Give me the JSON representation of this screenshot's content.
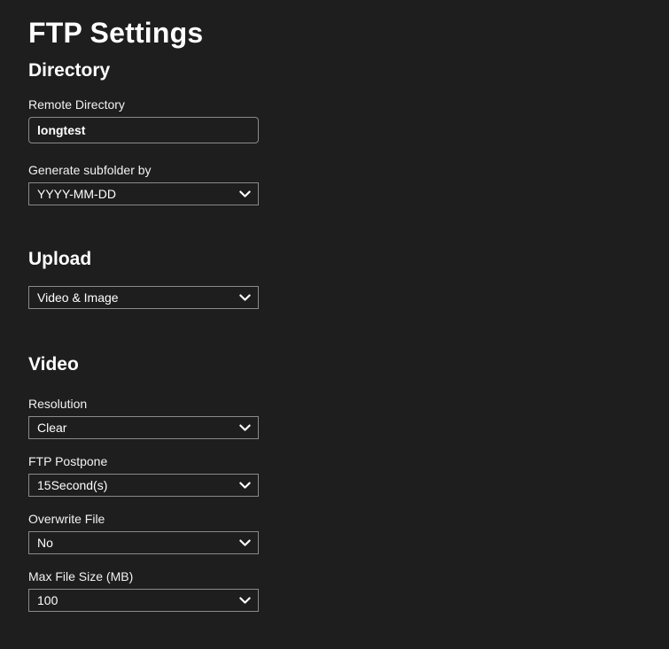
{
  "page": {
    "title": "FTP Settings",
    "background_color": "#1e1e1e",
    "text_color": "#ffffff",
    "border_color": "#8a8a8a"
  },
  "sections": {
    "directory": {
      "heading": "Directory",
      "remote_directory": {
        "label": "Remote Directory",
        "value": "longtest",
        "placeholder": ""
      },
      "generate_subfolder": {
        "label": "Generate subfolder by",
        "value": "YYYY-MM-DD"
      }
    },
    "upload": {
      "heading": "Upload",
      "type": {
        "label": "",
        "value": "Video & Image"
      }
    },
    "video": {
      "heading": "Video",
      "resolution": {
        "label": "Resolution",
        "value": "Clear"
      },
      "ftp_postpone": {
        "label": "FTP Postpone",
        "value": "15Second(s)"
      },
      "overwrite_file": {
        "label": "Overwrite File",
        "value": "No"
      },
      "max_file_size": {
        "label": "Max File Size (MB)",
        "value": "100"
      }
    }
  },
  "icons": {
    "chevron_down": "chevron-down-icon"
  }
}
